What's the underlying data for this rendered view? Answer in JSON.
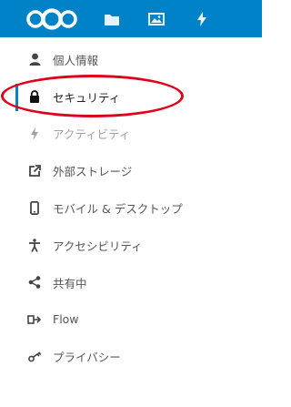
{
  "colors": {
    "header": "#0082c9",
    "annotation": "#e1001a",
    "active_bar": "#0082c9"
  },
  "header": {
    "icons": [
      "nextcloud-logo-icon",
      "files-icon",
      "gallery-icon",
      "activity-icon"
    ]
  },
  "sidebar": {
    "items": [
      {
        "label": "個人情報",
        "icon": "person-icon"
      },
      {
        "label": "セキュリティ",
        "icon": "lock-icon",
        "active": true
      },
      {
        "label": "アクティビティ",
        "icon": "lightning-icon"
      },
      {
        "label": "外部ストレージ",
        "icon": "external-link-icon"
      },
      {
        "label": "モバイル & デスクトップ",
        "icon": "phone-icon"
      },
      {
        "label": "アクセシビリティ",
        "icon": "accessibility-icon"
      },
      {
        "label": "共有中",
        "icon": "share-icon"
      },
      {
        "label": "Flow",
        "icon": "flow-icon"
      },
      {
        "label": "プライバシー",
        "icon": "key-icon"
      }
    ]
  }
}
